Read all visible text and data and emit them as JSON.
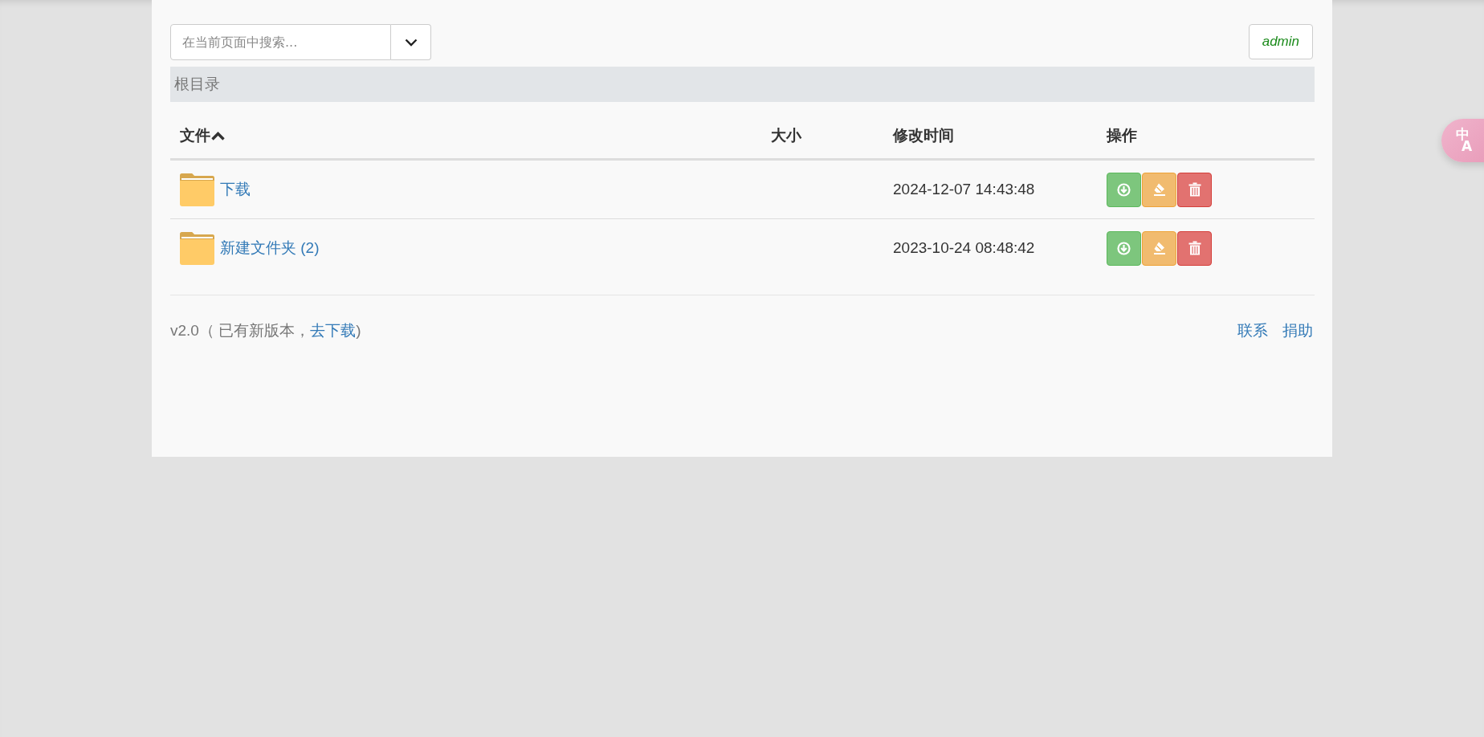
{
  "search": {
    "placeholder": "在当前页面中搜索..."
  },
  "user": {
    "name": "admin"
  },
  "breadcrumb": {
    "label": "根目录"
  },
  "table": {
    "columns": [
      {
        "label": "文件",
        "sorted": true
      },
      {
        "label": "大小",
        "sorted": false
      },
      {
        "label": "修改时间",
        "sorted": false
      },
      {
        "label": "操作",
        "sorted": false
      }
    ],
    "rows": [
      {
        "name": "下载",
        "kind": "folder",
        "size": "",
        "modified": "2024-12-07 14:43:48"
      },
      {
        "name": "新建文件夹 (2)",
        "kind": "folder",
        "size": "",
        "modified": "2023-10-24 08:48:42"
      }
    ]
  },
  "footer": {
    "version": "v2.0（ 已有新版本，",
    "link": "去下载",
    "tail": ")",
    "links": [
      "联系",
      "捐助"
    ]
  },
  "translate_button": {
    "label_top": "中",
    "label_bottom": "A"
  }
}
